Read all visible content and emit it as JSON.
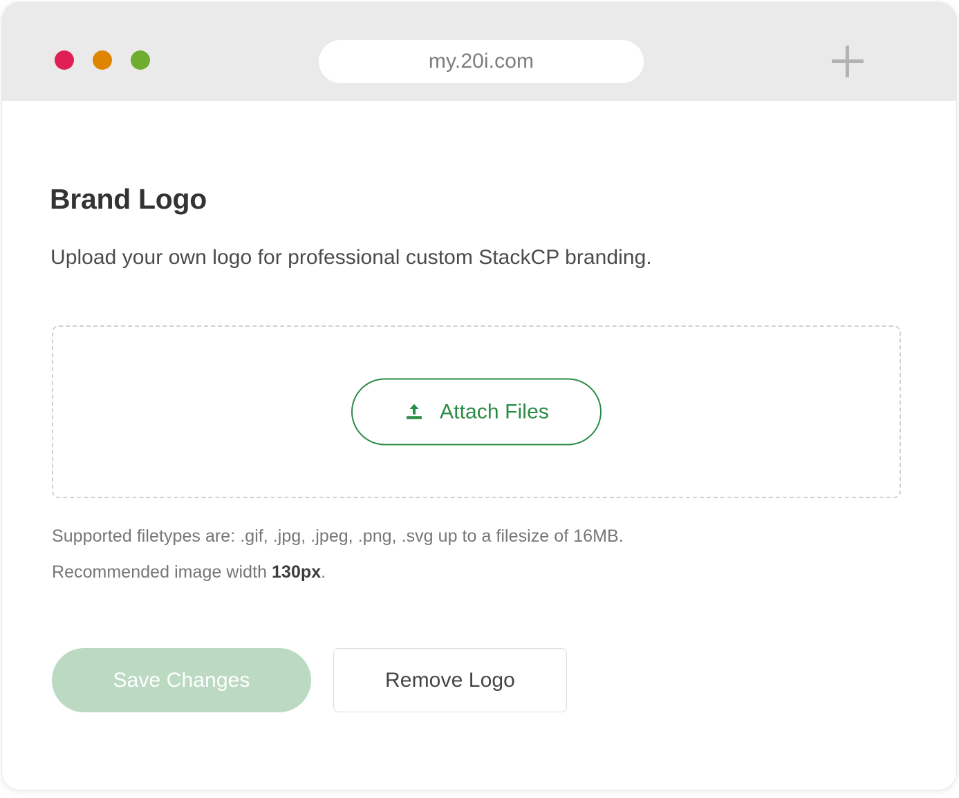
{
  "browser": {
    "url": "my.20i.com",
    "new_tab_label": "+",
    "traffic_lights": [
      {
        "name": "close",
        "color": "#e01f56"
      },
      {
        "name": "minimize",
        "color": "#df8403"
      },
      {
        "name": "maximize",
        "color": "#6fad30"
      }
    ]
  },
  "page": {
    "title": "Brand Logo",
    "subtitle": "Upload your own logo for professional custom StackCP branding."
  },
  "dropzone": {
    "attach_button_label": "Attach Files",
    "attach_icon": "upload-icon"
  },
  "help": {
    "line1": "Supported filetypes are: .gif, .jpg, .jpeg, .png, .svg up to a filesize of 16MB.",
    "line2_prefix": "Recommended image width ",
    "line2_value": "130px",
    "line2_suffix": "."
  },
  "actions": {
    "save_label": "Save Changes",
    "remove_label": "Remove Logo"
  },
  "colors": {
    "accent_green": "#2a8b44",
    "save_disabled_green": "#bcd9c2",
    "chrome_gray": "#eaeaea",
    "dropzone_border": "#d0d0d0"
  }
}
